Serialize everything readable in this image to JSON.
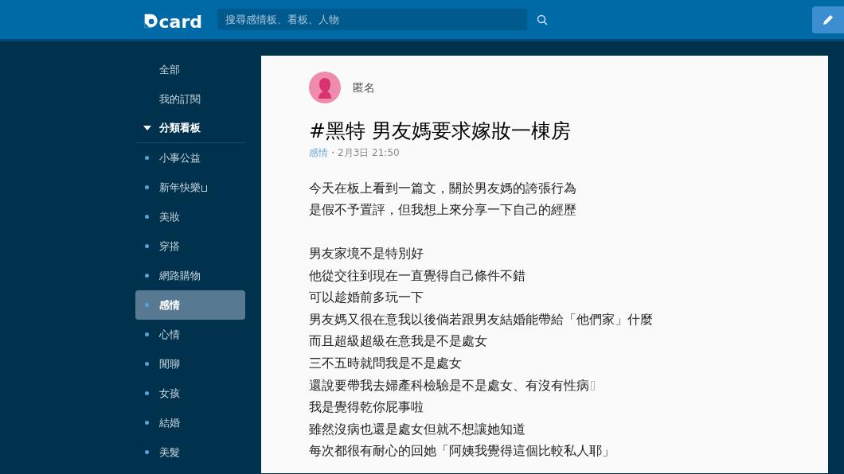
{
  "header": {
    "logo_text": "card",
    "search": {
      "placeholder": "搜尋感情板、看板、人物"
    }
  },
  "sidebar": {
    "items": [
      {
        "label": "全部",
        "selected": false
      },
      {
        "label": "我的訂閱",
        "selected": false
      }
    ],
    "section": {
      "label": "分類看板",
      "expanded": true
    },
    "boards": [
      {
        "label": "小事公益",
        "selected": false,
        "missing_glyph": false
      },
      {
        "label": "新年快樂",
        "selected": false,
        "missing_glyph": true
      },
      {
        "label": "美妝",
        "selected": false,
        "missing_glyph": false
      },
      {
        "label": "穿搭",
        "selected": false,
        "missing_glyph": false
      },
      {
        "label": "網路購物",
        "selected": false,
        "missing_glyph": false
      },
      {
        "label": "感情",
        "selected": true,
        "missing_glyph": false
      },
      {
        "label": "心情",
        "selected": false,
        "missing_glyph": false
      },
      {
        "label": "閒聊",
        "selected": false,
        "missing_glyph": false
      },
      {
        "label": "女孩",
        "selected": false,
        "missing_glyph": false
      },
      {
        "label": "結婚",
        "selected": false,
        "missing_glyph": false
      },
      {
        "label": "美髮",
        "selected": false,
        "missing_glyph": false
      }
    ]
  },
  "post": {
    "author": "匿名",
    "title": "#黑特 男友媽要求嫁妝一棟房",
    "board": "感情",
    "time": "・2月3日 21:50",
    "paragraphs": [
      [
        {
          "text": "今天在板上看到一篇文，關於男友媽的誇張行為",
          "missing_glyph": false
        },
        {
          "text": "是假不予置評，但我想上來分享一下自己的經歷",
          "missing_glyph": false
        }
      ],
      [
        {
          "text": "男友家境不是特別好",
          "missing_glyph": false
        },
        {
          "text": "他從交往到現在一直覺得自己條件不錯",
          "missing_glyph": false
        },
        {
          "text": "可以趁婚前多玩一下",
          "missing_glyph": false
        },
        {
          "text": "男友媽又很在意我以後倘若跟男友結婚能帶給「他們家」什麼",
          "missing_glyph": false
        },
        {
          "text": "而且超級超級在意我是不是處女",
          "missing_glyph": false
        },
        {
          "text": "三不五時就問我是不是處女",
          "missing_glyph": false
        },
        {
          "text": "還說要帶我去婦產科檢驗是不是處女、有沒有性病",
          "missing_glyph": true
        },
        {
          "text": "我是覺得乾你屁事啦",
          "missing_glyph": false
        },
        {
          "text": "雖然沒病也還是處女但就不想讓她知道",
          "missing_glyph": false
        },
        {
          "text": "每次都很有耐心的回她「阿姨我覺得這個比較私人耶」",
          "missing_glyph": false
        }
      ]
    ]
  }
}
